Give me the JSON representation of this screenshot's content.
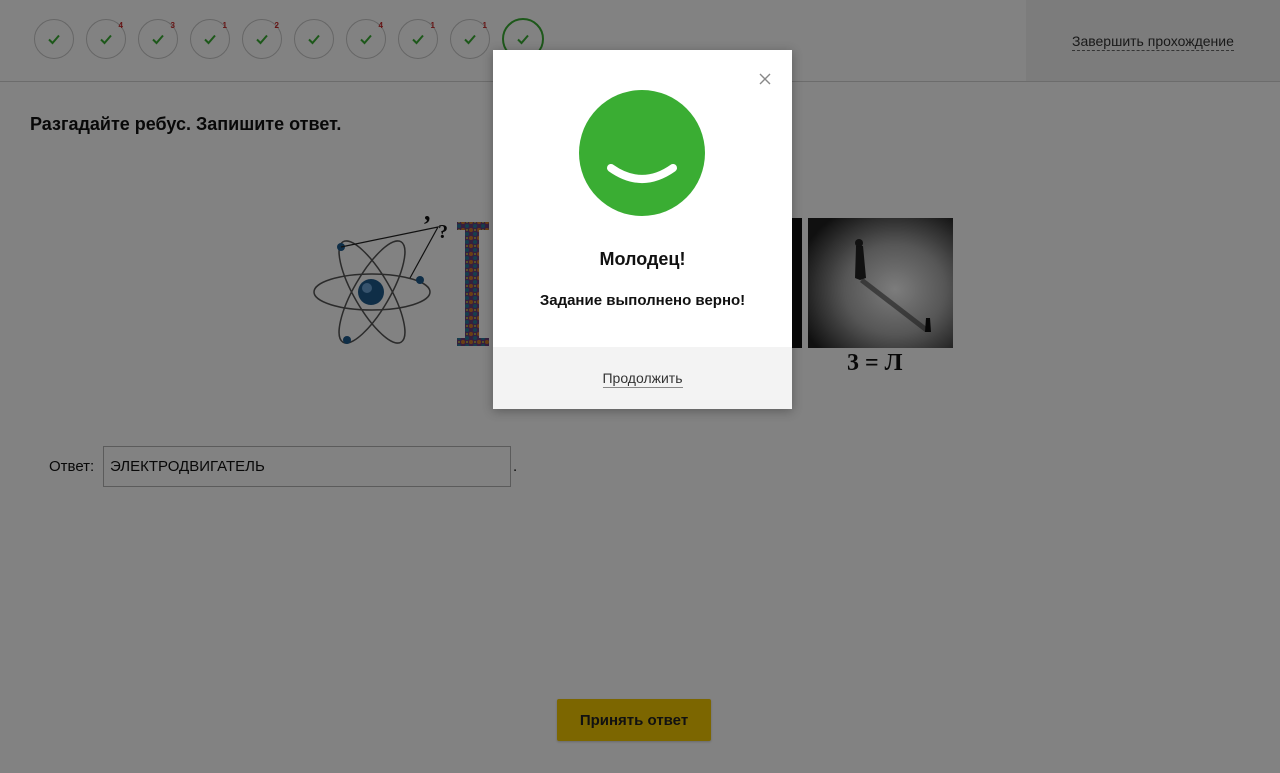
{
  "progress": {
    "steps": [
      {
        "badge": ""
      },
      {
        "badge": "4"
      },
      {
        "badge": "3"
      },
      {
        "badge": "1"
      },
      {
        "badge": "2"
      },
      {
        "badge": ""
      },
      {
        "badge": "4"
      },
      {
        "badge": "1"
      },
      {
        "badge": "1"
      },
      {
        "badge": ""
      }
    ],
    "finish_label": "Завершить прохождение"
  },
  "task": {
    "title": "Разгадайте ребус. Запишите ответ.",
    "rebus_caption": "3 = Л",
    "answer_label": "Ответ:",
    "answer_value": "ЭЛЕКТРОДВИГАТЕЛЬ",
    "answer_suffix": ".",
    "submit_label": "Принять ответ"
  },
  "modal": {
    "title": "Молодец!",
    "message": "Задание выполнено верно!",
    "continue_label": "Продолжить"
  },
  "colors": {
    "success": "#3aad33",
    "button": "#f3c800",
    "badge": "#c62828"
  }
}
